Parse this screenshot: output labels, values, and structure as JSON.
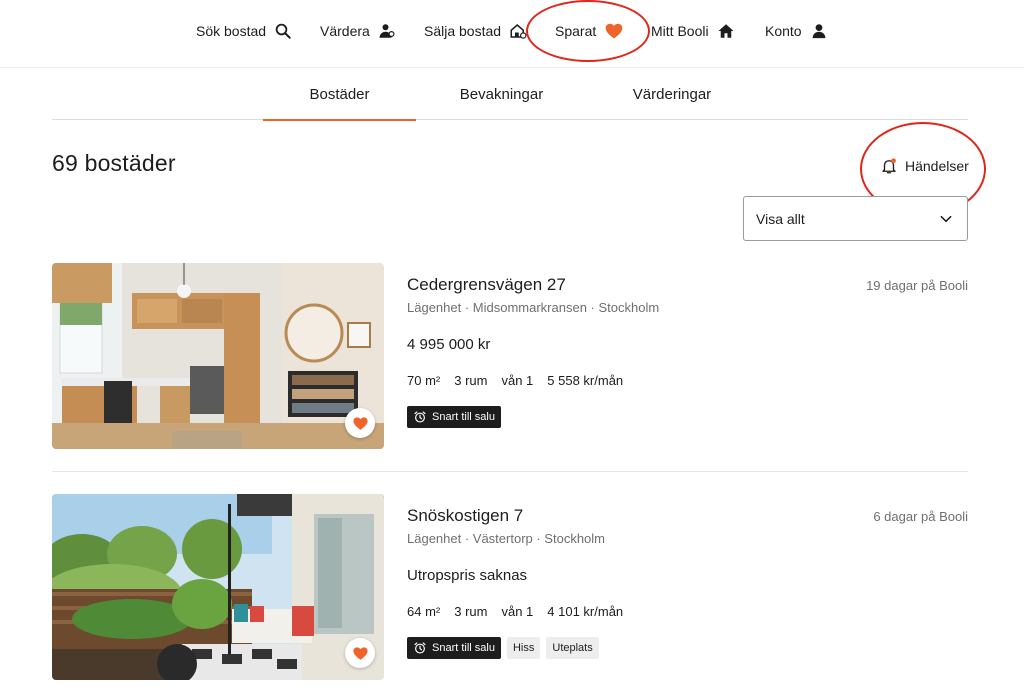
{
  "colors": {
    "accent": "#f0642a",
    "annotation": "#e0261b",
    "text": "#1d1d1d",
    "muted": "#6f6f6f"
  },
  "nav": {
    "items": [
      {
        "label": "Sök bostad",
        "icon": "search-icon"
      },
      {
        "label": "Värdera",
        "icon": "person-value-icon"
      },
      {
        "label": "Sälja bostad",
        "icon": "house-sell-icon"
      },
      {
        "label": "Sparat",
        "icon": "heart-icon"
      },
      {
        "label": "Mitt Booli",
        "icon": "home-icon"
      },
      {
        "label": "Konto",
        "icon": "user-icon"
      }
    ]
  },
  "tabs": [
    {
      "label": "Bostäder",
      "active": true
    },
    {
      "label": "Bevakningar",
      "active": false
    },
    {
      "label": "Värderingar",
      "active": false
    }
  ],
  "summary": {
    "title": "69 bostäder"
  },
  "events": {
    "label": "Händelser",
    "icon": "bell-icon"
  },
  "filter": {
    "selected": "Visa allt"
  },
  "listings": [
    {
      "address": "Cedergrensvägen 27",
      "meta": "Lägenhet · Midsommarkransen · Stockholm",
      "days": "19 dagar på Booli",
      "price": "4 995 000 kr",
      "facts": [
        "70 m²",
        "3 rum",
        "vån 1",
        "5 558 kr/mån"
      ],
      "badges": [
        {
          "label": "Snart till salu",
          "style": "dark"
        }
      ],
      "photo": "kitchen-photo"
    },
    {
      "address": "Snöskostigen 7",
      "meta": "Lägenhet · Västertorp · Stockholm",
      "days": "6 dagar på Booli",
      "price": "Utropspris saknas",
      "facts": [
        "64 m²",
        "3 rum",
        "vån 1",
        "4 101 kr/mån"
      ],
      "badges": [
        {
          "label": "Snart till salu",
          "style": "dark"
        },
        {
          "label": "Hiss",
          "style": "light"
        },
        {
          "label": "Uteplats",
          "style": "light"
        }
      ],
      "photo": "balcony-photo"
    }
  ]
}
